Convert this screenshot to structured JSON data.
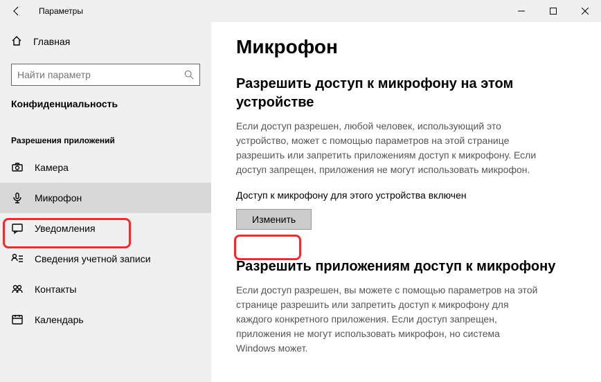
{
  "window": {
    "title": "Параметры"
  },
  "sidebar": {
    "home": "Главная",
    "search_placeholder": "Найти параметр",
    "category": "Конфиденциальность",
    "group": "Разрешения приложений",
    "items": [
      {
        "label": "Камера"
      },
      {
        "label": "Микрофон"
      },
      {
        "label": "Уведомления"
      },
      {
        "label": "Сведения учетной записи"
      },
      {
        "label": "Контакты"
      },
      {
        "label": "Календарь"
      }
    ]
  },
  "main": {
    "title": "Микрофон",
    "section1": {
      "heading": "Разрешить доступ к микрофону на этом устройстве",
      "body": "Если доступ разрешен, любой человек, использующий это устройство, может с помощью параметров на этой странице разрешить или запретить приложениям доступ к микрофону. Если доступ запрещен, приложения не могут использовать микрофон.",
      "status": "Доступ к микрофону для этого устройства включен",
      "button": "Изменить"
    },
    "section2": {
      "heading": "Разрешить приложениям доступ к микрофону",
      "body": "Если доступ разрешен, вы можете с помощью параметров на этой странице разрешить или запретить доступ к микрофону для каждого конкретного приложения. Если доступ запрещен, приложения не могут использовать микрофон, но система Windows может."
    }
  }
}
